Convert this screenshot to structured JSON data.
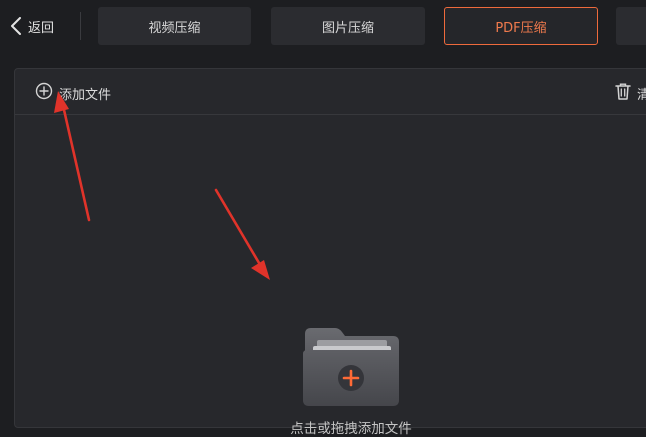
{
  "header": {
    "back_label": "返回",
    "tabs": [
      {
        "label": "视频压缩",
        "active": false
      },
      {
        "label": "图片压缩",
        "active": false
      },
      {
        "label": "PDF压缩",
        "active": true
      },
      {
        "label": "",
        "active": false
      }
    ]
  },
  "toolbar": {
    "add_file_label": "添加文件",
    "clear_label": "清"
  },
  "dropzone": {
    "hint": "点击或拖拽添加文件"
  },
  "icons": {
    "back": "chevron-left-icon",
    "add": "plus-circle-icon",
    "trash": "trash-icon",
    "folder": "folder-plus-icon",
    "arrow": "red-arrow-annotation"
  },
  "colors": {
    "accent": "#ee6a3c",
    "arrow": "#e0332a",
    "background": "#1d1e21",
    "panel": "#27282c",
    "tab": "#2b2c30"
  }
}
